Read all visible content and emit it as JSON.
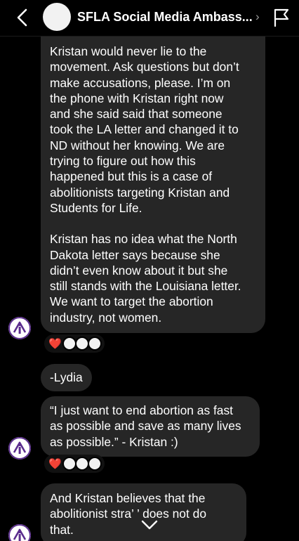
{
  "header": {
    "title": "SFLA Social Media Ambass...",
    "chevron": "›"
  },
  "messages": [
    {
      "paragraphs": [
        "Kristan would never lie to the\nmovement. Ask questions but don’t\nmake accusations, please. I’m on\nthe phone with Kristan right now\nand she said said that someone\ntook the LA letter and changed it to\nND without her knowing. We are\ntrying to figure out how this\nhappened but this is a case of\nabolitionists targeting Kristan and\nStudents for Life.",
        "Kristan has no idea what the North\nDakota letter says because she\ndidn’t even know about it but she\nstill stands with the Louisiana letter.\nWe want to target the abortion\nindustry, not women."
      ],
      "reaction": "❤️"
    },
    {
      "text": "-Lydia"
    },
    {
      "text": "“I just want to end abortion as fast\nas possible and save as many lives\nas possible.” - Kristan :)",
      "reaction": "❤️"
    },
    {
      "text": "And Kristan believes that the\nabolitionist stra’     ’ does not do\nthat."
    }
  ],
  "colors": {
    "bubble": "#262626",
    "background": "#000000",
    "heart": "#e0245e",
    "avatar_accent": "#5b2d8e"
  }
}
